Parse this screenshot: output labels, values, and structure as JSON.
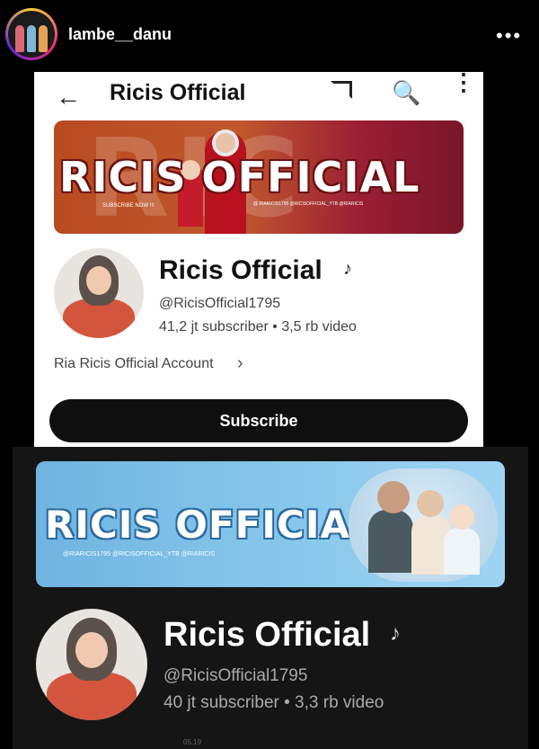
{
  "post": {
    "username": "lambe__danu",
    "more_icon": "more-horizontal-icon"
  },
  "light": {
    "app_title": "Ricis Official",
    "banner_text": "RICIS OFFICIAL",
    "banner_watermark": "RIC",
    "banner_subscribe": "SUBSCRIBE NOW !!!",
    "banner_socials": "@ RIARICIS1795   @RICISOFFICIAL_YTB   @RIARICIS",
    "channel_name": "Ricis Official",
    "handle": "@RicisOfficial1795",
    "stats": "41,2 jt subscriber • 3,5 rb video",
    "description": "Ria Ricis Official Account",
    "subscribe_label": "Subscribe",
    "colors": {
      "banner": "#b84a1f",
      "button": "#0f0f0f"
    }
  },
  "dark": {
    "banner_text": "RICIS OFFICIAL",
    "banner_socials": "@RIARICIS1795   @RICISOFFICIAL_YTB   @RIARICIS",
    "channel_name": "Ricis Official",
    "handle": "@RicisOfficial1795",
    "stats": "40 jt subscriber • 3,3 rb video",
    "timestamp": "05.19",
    "colors": {
      "banner": "#86c6ea",
      "background": "#151515"
    }
  }
}
